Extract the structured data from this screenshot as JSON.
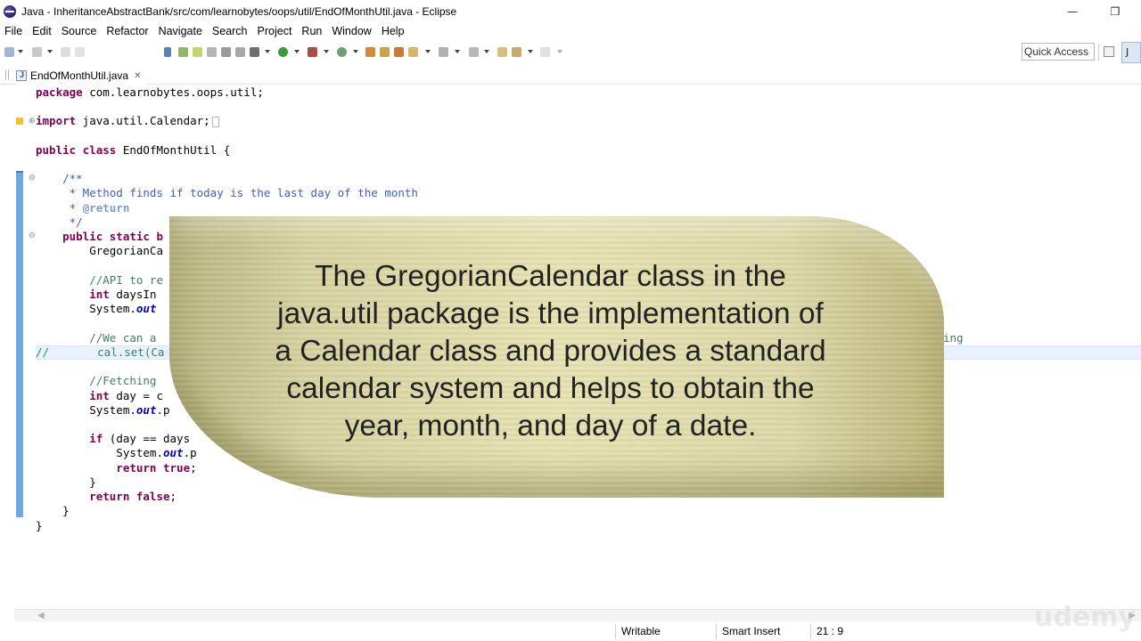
{
  "window": {
    "title": "Java - InheritanceAbstractBank/src/com/learnobytes/oops/util/EndOfMonthUtil.java - Eclipse",
    "minimize_glyph": "—",
    "maximize_glyph": "❐"
  },
  "menu": {
    "items": [
      "File",
      "Edit",
      "Source",
      "Refactor",
      "Navigate",
      "Search",
      "Project",
      "Run",
      "Window",
      "Help"
    ]
  },
  "toolbar": {
    "quick_access": "Quick Access",
    "perspective_label": "J"
  },
  "editor": {
    "tab_label": "EndOfMonthUtil.java",
    "tab_close": "✕",
    "code": {
      "l1_kw": "package",
      "l1_rest": " com.learnobytes.oops.util;",
      "l3_kw": "import",
      "l3_rest": " java.util.Calendar;",
      "l5_kw1": "public",
      "l5_kw2": "class",
      "l5_rest": " EndOfMonthUtil {",
      "l7": "    /**",
      "l8": "     * Method finds if today is the last day of the month",
      "l9_star": "     * ",
      "l9_tag": "@return",
      "l10": "     */",
      "l11_kw": "    public static b",
      "l12": "        GregorianCa",
      "l14": "        //API to re",
      "l15_kw": "        int",
      "l15_rest": " daysIn",
      "l16_a": "        System.",
      "l16_fld": "out",
      "l18": "        //We can a",
      "l18_tail": "ing",
      "l19_prefix": "//",
      "l19": "      cal.set(Ca",
      "l21": "        //Fetching",
      "l22_kw": "        int",
      "l22_rest": " day = c",
      "l23_a": "        System.",
      "l23_fld": "out",
      "l23_b": ".p",
      "l25_kw": "        if",
      "l25_rest": " (day == days",
      "l26_a": "            System.",
      "l26_fld": "out",
      "l26_b": ".p",
      "l27_kw1": "            return",
      "l27_kw2": " true",
      "l27_rest": ";",
      "l28": "        }",
      "l29_kw1": "        return",
      "l29_kw2": " false",
      "l29_rest": ";",
      "l30": "    }",
      "l31": "}"
    }
  },
  "statusbar": {
    "writable": "Writable",
    "insert_mode": "Smart Insert",
    "position": "21 : 9"
  },
  "overlay": {
    "line1": "The GregorianCalendar class in the",
    "line2": "java.util package is the implementation of",
    "line3": "a Calendar class and provides a standard",
    "line4": "calendar system and helps to obtain the",
    "line5": "year, month, and day of a date."
  },
  "watermark": "udemy",
  "colors": {
    "keyword": "#7f0055",
    "javadoc": "#3f5fbf",
    "comment": "#3f7f5f",
    "field": "#0000c0",
    "ruler_marker": "#6fa9df",
    "banner": "#d6d2a0"
  }
}
